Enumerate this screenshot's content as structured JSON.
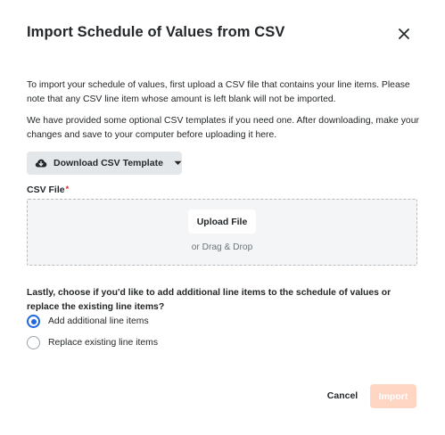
{
  "modal": {
    "title": "Import Schedule of Values from CSV",
    "close_icon": "close-icon"
  },
  "intro": {
    "paragraph1": "To import your schedule of values, first upload a CSV file that contains your line items. Please note that any CSV line item whose amount is left blank will not be imported.",
    "paragraph2": "We have provided some optional CSV templates if you need one. After downloading, make your changes and save to your computer before uploading it here."
  },
  "download": {
    "label": "Download CSV Template",
    "icon": "cloud-download-icon",
    "caret_icon": "caret-down-icon"
  },
  "csv_field": {
    "label": "CSV File",
    "required_mark": "*",
    "upload_label": "Upload File",
    "drag_text": "or Drag & Drop"
  },
  "options": {
    "question": "Lastly, choose if you'd like to add additional line items to the schedule of values or replace the existing line items?",
    "items": [
      {
        "label": "Add additional line items",
        "checked": true
      },
      {
        "label": "Replace existing line items",
        "checked": false
      }
    ]
  },
  "footer": {
    "cancel_label": "Cancel",
    "import_label": "Import"
  },
  "colors": {
    "accent": "#2066df",
    "import_disabled_bg": "#ffd5c4",
    "required": "#d92626"
  }
}
